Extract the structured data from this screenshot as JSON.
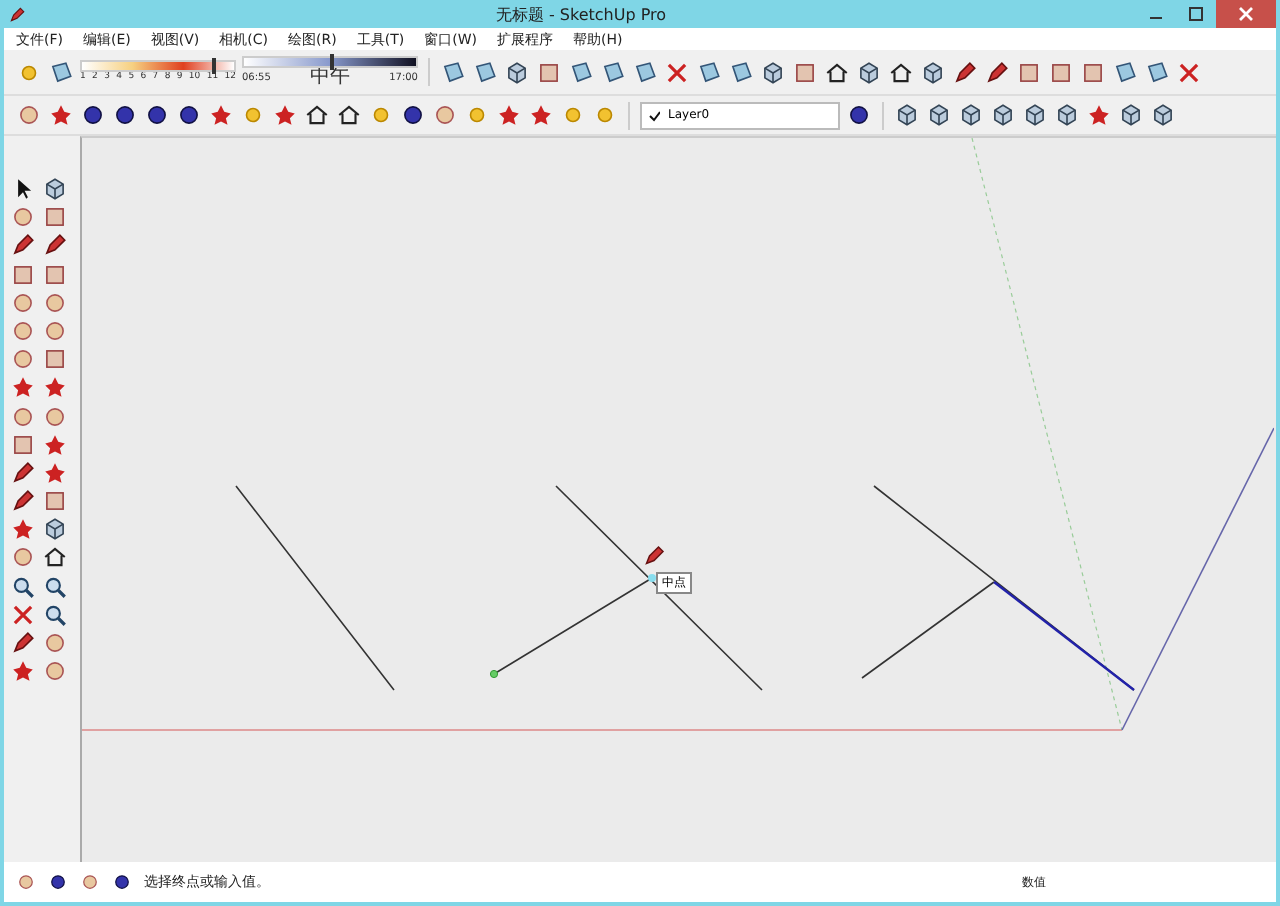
{
  "window": {
    "title": "无标题 - SketchUp Pro"
  },
  "menu": [
    "文件(F)",
    "编辑(E)",
    "视图(V)",
    "相机(C)",
    "绘图(R)",
    "工具(T)",
    "窗口(W)",
    "扩展程序",
    "帮助(H)"
  ],
  "shadow_settings": {
    "month_slider": {
      "level": 0.85,
      "labels": [
        "1",
        "2",
        "3",
        "4",
        "5",
        "6",
        "7",
        "8",
        "9",
        "10",
        "11",
        "12"
      ]
    },
    "time_slider": {
      "level": 0.5,
      "labels": [
        "06:55",
        "中午",
        "17:00"
      ]
    }
  },
  "layer_select": {
    "value": "Layer0"
  },
  "canvas": {
    "tooltip": "中点"
  },
  "status_bar": {
    "message": "选择终点或输入值。",
    "measurement_label": "数值"
  }
}
